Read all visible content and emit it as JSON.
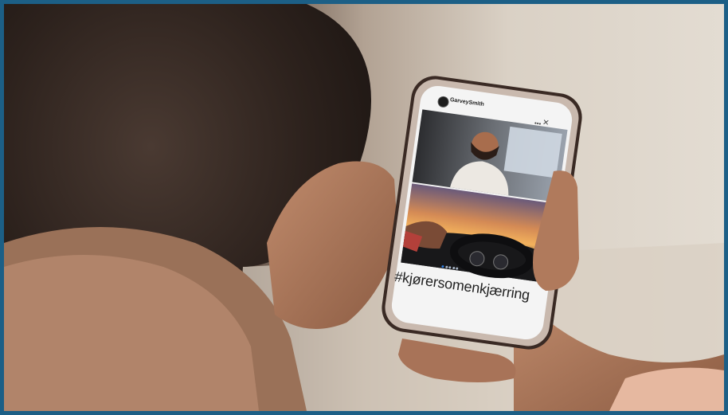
{
  "post": {
    "username": "GarveySmith",
    "more_icon": "ellipsis-icon",
    "close_icon": "close-icon",
    "hashtag": "#kjørersomenkjærring",
    "carousel": {
      "count": 5,
      "active_index": 0
    }
  },
  "colors": {
    "frame_border": "#1c5f86",
    "carousel_active": "#2f7de0",
    "carousel_inactive": "#aab7c8"
  }
}
